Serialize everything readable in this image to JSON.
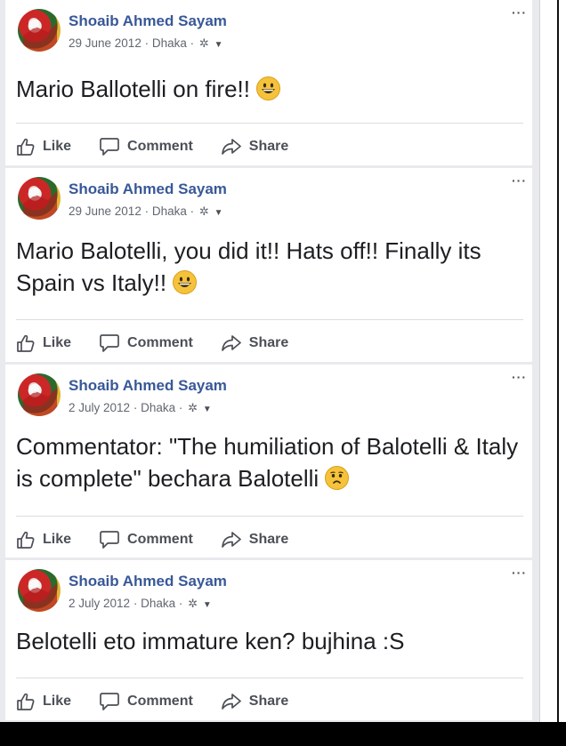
{
  "posts": [
    {
      "author": "Shoaib Ahmed Sayam",
      "date": "29 June 2012",
      "location": "Dhaka",
      "text": "Mario Ballotelli on fire!!",
      "emoji": "grin-emoji",
      "actions": {
        "like": "Like",
        "comment": "Comment",
        "share": "Share"
      }
    },
    {
      "author": "Shoaib Ahmed Sayam",
      "date": "29 June 2012",
      "location": "Dhaka",
      "text": "Mario Balotelli, you did it!! Hats off!! Finally its Spain vs Italy!!",
      "emoji": "grin-emoji",
      "actions": {
        "like": "Like",
        "comment": "Comment",
        "share": "Share"
      }
    },
    {
      "author": "Shoaib Ahmed Sayam",
      "date": "2 July 2012",
      "location": "Dhaka",
      "text": "Commentator: \"The humiliation of Balotelli & Italy is complete\" bechara Balotelli",
      "emoji": "sad-emoji",
      "actions": {
        "like": "Like",
        "comment": "Comment",
        "share": "Share"
      }
    },
    {
      "author": "Shoaib Ahmed Sayam",
      "date": "2 July 2012",
      "location": "Dhaka",
      "text": "Belotelli eto immature ken? bujhina :S",
      "emoji": "",
      "actions": {
        "like": "Like",
        "comment": "Comment",
        "share": "Share"
      }
    }
  ],
  "meta_separator": "·",
  "privacy_icon": "gear-icon",
  "more_label": "···",
  "colors": {
    "author": "#385898",
    "meta": "#616770",
    "text": "#1c1e21",
    "action": "#4b4f56",
    "feed_bg": "#e9eaee",
    "emoji": "#f5c33b"
  }
}
